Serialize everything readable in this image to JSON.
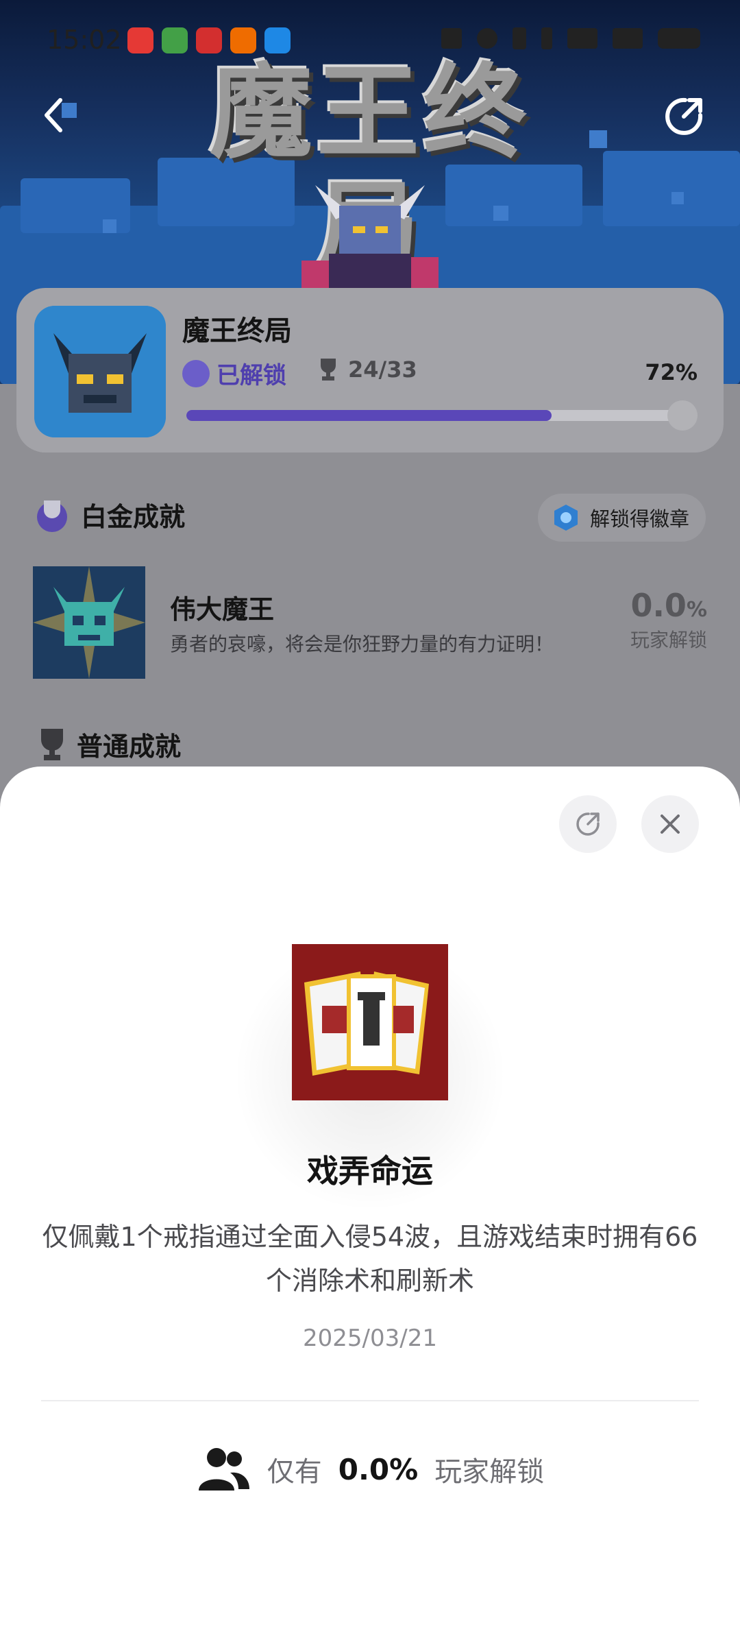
{
  "status_bar": {
    "time": "15:02",
    "app_icons": [
      "xiaohongshu-icon",
      "messages-icon",
      "bank-icon",
      "taobao-icon",
      "maps-icon"
    ]
  },
  "header": {
    "game_title_art": "魔王终局"
  },
  "game": {
    "name": "魔王终局",
    "unlocked_label": "已解锁",
    "trophy_count": "24/33",
    "progress_percent": "72%",
    "progress_fraction": 0.72
  },
  "platinum_section": {
    "title": "白金成就",
    "badge_label": "解锁得徽章",
    "item": {
      "title": "伟大魔王",
      "description": "勇者的哀嚎，将会是你狂野力量的有力证明！",
      "rate_value": "0.0",
      "rate_unit": "%",
      "rate_label": "玩家解锁"
    }
  },
  "normal_section": {
    "title": "普通成就"
  },
  "sheet": {
    "achievement_title": "戏弄命运",
    "achievement_description": "仅佩戴1个戒指通过全面入侵54波，且游戏结束时拥有66个消除术和刷新术",
    "date": "2025/03/21",
    "stat_prefix": "仅有",
    "stat_value": "0.0%",
    "stat_suffix": "玩家解锁"
  },
  "colors": {
    "accent": "#5a47b8",
    "unlocked_text": "#4f3fae",
    "card_art_red": "#8b1a1a"
  }
}
